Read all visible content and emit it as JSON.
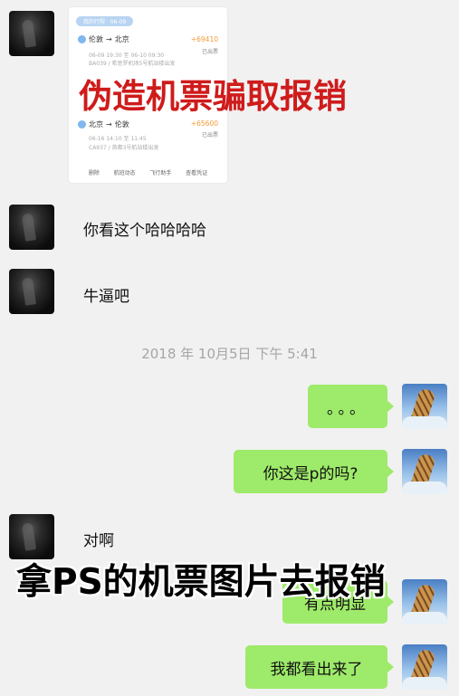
{
  "ticket_card": {
    "pill": "我的行程 · 06-09",
    "trip1": {
      "from": "伦敦",
      "arrow": "→",
      "to": "北京",
      "price": "+69410",
      "status": "已出票",
      "time_line": "06-09 19:30 至 06-10 09:30",
      "detail_line": "BA039 / 希思罗机场5号航站楼出发"
    },
    "trip2": {
      "from": "北京",
      "arrow": "→",
      "to": "伦敦",
      "price": "+65600",
      "status": "已出票",
      "time_line": "06-16 14:10 至 11:45",
      "detail_line": "CA937 / 首都3号航站楼出发"
    },
    "actions": [
      "删除",
      "航班动态",
      "飞行助手",
      "查看凭证"
    ]
  },
  "overlays": {
    "top_caption": "伪造机票骗取报销",
    "bottom_caption": "拿PS的机票图片去报销"
  },
  "messages": {
    "m1": "你看这个哈哈哈哈",
    "m2": "牛逼吧",
    "timestamp": "2018 年 10月5日 下午 5:41",
    "m3": "。。。",
    "m4": "你这是p的吗?",
    "m5": "对啊",
    "m6": "有点明显",
    "m7": "我都看出来了"
  },
  "colors": {
    "bubble_green": "#9eea6a",
    "caption_red": "#cf1b1b",
    "background": "#f1f1f1"
  }
}
